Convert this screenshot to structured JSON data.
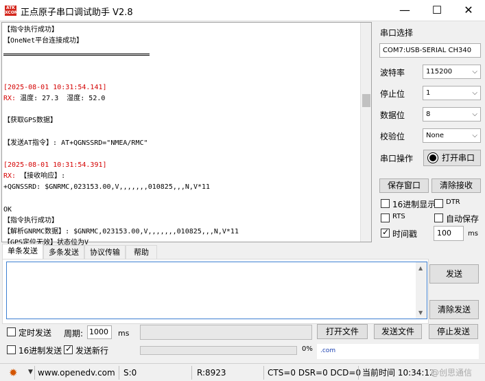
{
  "title": "正点原子串口调试助手 V2.8",
  "logo_text": "ATK XCOM",
  "window_controls": {
    "minimize": "—",
    "maximize": "☐",
    "close": "✕"
  },
  "receive": {
    "lines": [
      "【指令执行成功】",
      "【OneNet平台连接成功】",
      "",
      "",
      "[2025-08-01 10:31:54.141]",
      "温度: 27.3  湿度: 52.0",
      "",
      "【获取GPS数据】",
      "",
      "【发送AT指令】: AT+QGNSSRD=\"NMEA/RMC\"",
      "",
      "[2025-08-01 10:31:54.391]",
      "【接收响应】:",
      "+QGNSSRD: $GNRMC,023153.00,V,,,,,,,010825,,,N,V*11",
      "",
      "OK",
      "【指令执行成功】",
      "【解析GNRMC数据】: $GNRMC,023153.00,V,,,,,,,010825,,,N,V*11",
      "【GPS定位无效】状态位为V"
    ],
    "rx_prefix": "RX:"
  },
  "panel": {
    "port_select_label": "串口选择",
    "port_value": "COM7:USB-SERIAL CH340",
    "baud_label": "波特率",
    "baud_value": "115200",
    "stopbit_label": "停止位",
    "stopbit_value": "1",
    "databit_label": "数据位",
    "databit_value": "8",
    "parity_label": "校验位",
    "parity_value": "None",
    "port_op_label": "串口操作",
    "open_port_label": "打开串口",
    "save_window_label": "保存窗口",
    "clear_recv_label": "清除接收",
    "hex_display_label": "16进制显示",
    "dtr_label": "DTR",
    "rts_label": "RTS",
    "auto_save_label": "自动保存",
    "timestamp_label": "时间戳",
    "timestamp_value": "100",
    "timestamp_unit": "ms"
  },
  "tabs": [
    "单条发送",
    "多条发送",
    "协议传输",
    "帮助"
  ],
  "send": {
    "send_label": "发送",
    "clear_send_label": "清除发送",
    "timed_send_label": "定时发送",
    "period_label": "周期:",
    "period_value": "1000",
    "period_unit": "ms",
    "open_file_label": "打开文件",
    "send_file_label": "发送文件",
    "stop_send_label": "停止发送",
    "hex_send_label": "16进制发送",
    "send_newline_label": "发送新行",
    "progress_text": "0%",
    "progress": 0,
    "link_text": ".com"
  },
  "status": {
    "website": "www.openedv.com",
    "s_count": "S:0",
    "r_count": "R:8923",
    "lines": "CTS=0 DSR=0 DCD=0",
    "time": "当前时间 10:34:12",
    "watermark": "@创思通信"
  }
}
